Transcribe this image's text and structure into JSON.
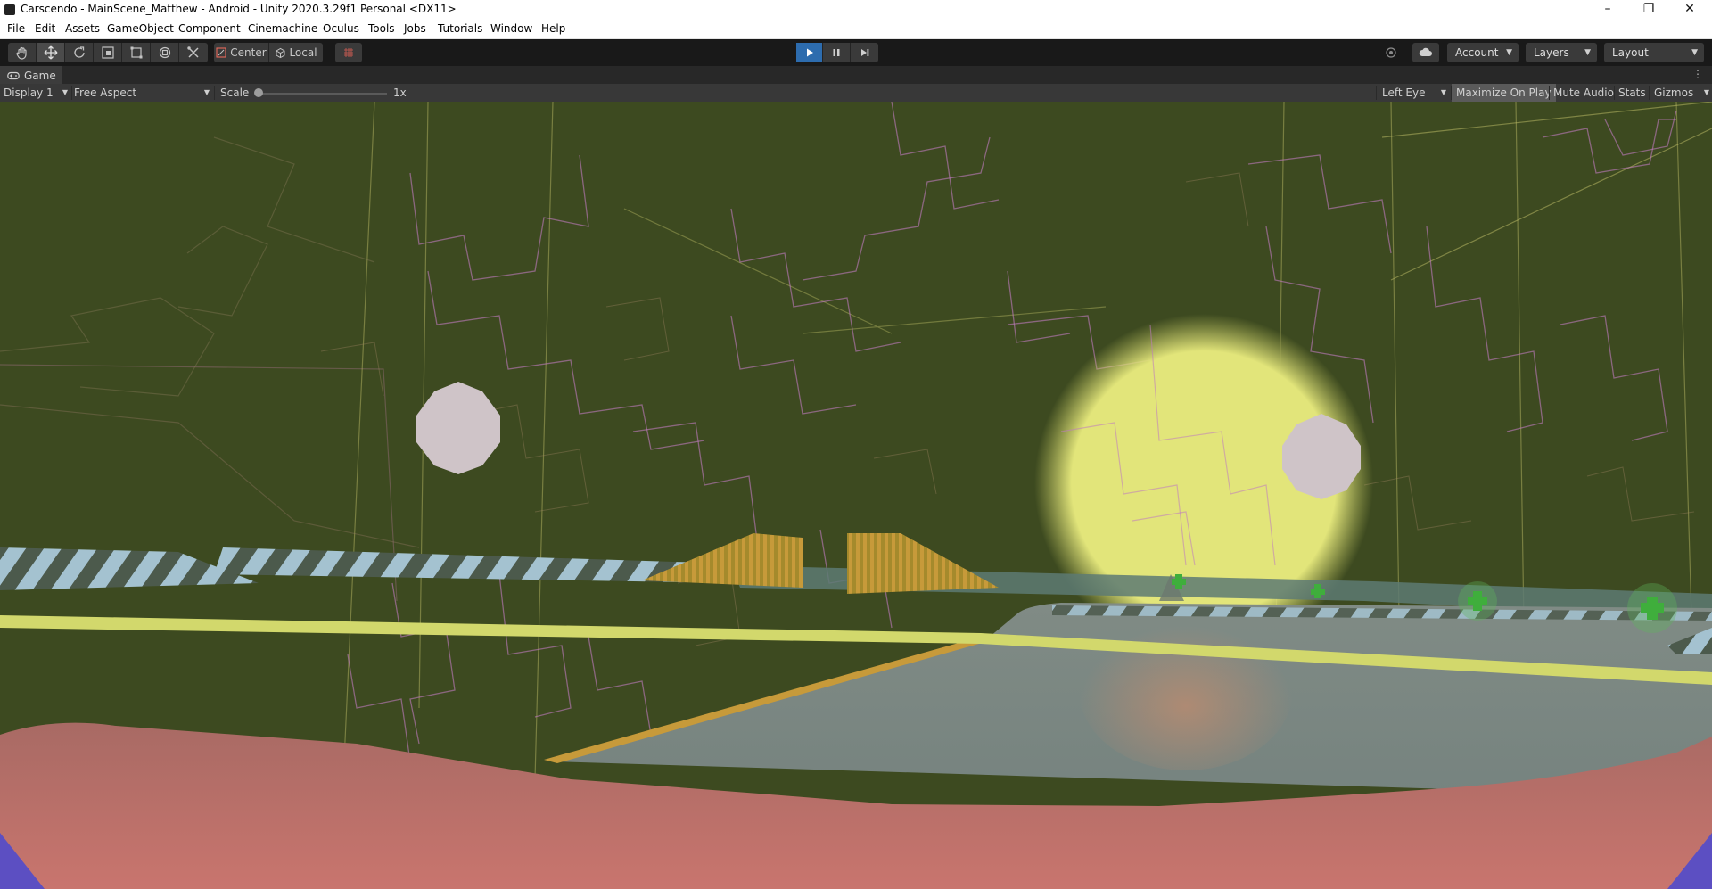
{
  "window": {
    "title": "Carscendo - MainScene_Matthew - Android - Unity 2020.3.29f1 Personal <DX11>",
    "minimize_icon": "minimize-icon",
    "maximize_icon": "restore-icon",
    "close_icon": "close-icon"
  },
  "menu": [
    "File",
    "Edit",
    "Assets",
    "GameObject",
    "Component",
    "Cinemachine",
    "Oculus",
    "Tools",
    "Jobs",
    "Tutorials",
    "Window",
    "Help"
  ],
  "toolbar": {
    "tools": [
      "hand-tool-icon",
      "move-tool-icon",
      "rotate-tool-icon",
      "scale-tool-icon",
      "rect-tool-icon",
      "transform-tool-icon",
      "custom-tool-icon"
    ],
    "active_tool": "move-tool-icon",
    "pivot_label": "Center",
    "space_label": "Local",
    "play_icons": [
      "play-icon",
      "pause-icon",
      "step-icon"
    ],
    "account_label": "Account",
    "layers_label": "Layers",
    "layout_label": "Layout"
  },
  "game_view": {
    "tab_label": "Game",
    "display_label": "Display 1",
    "aspect_label": "Free Aspect",
    "scale_label": "Scale",
    "scale_value": "1x",
    "eye_label": "Left Eye",
    "maximize_label": "Maximize On Play",
    "mute_label": "Mute Audio",
    "stats_label": "Stats",
    "gizmos_label": "Gizmos"
  },
  "colors": {
    "accent_play": "#2d6cae",
    "scene_background": "#3d4a20",
    "sun": "#e2e57a",
    "track_stripe": "#a4c2d0",
    "floor": "#7f8c83",
    "foreground_pink": "#c56f6c"
  }
}
